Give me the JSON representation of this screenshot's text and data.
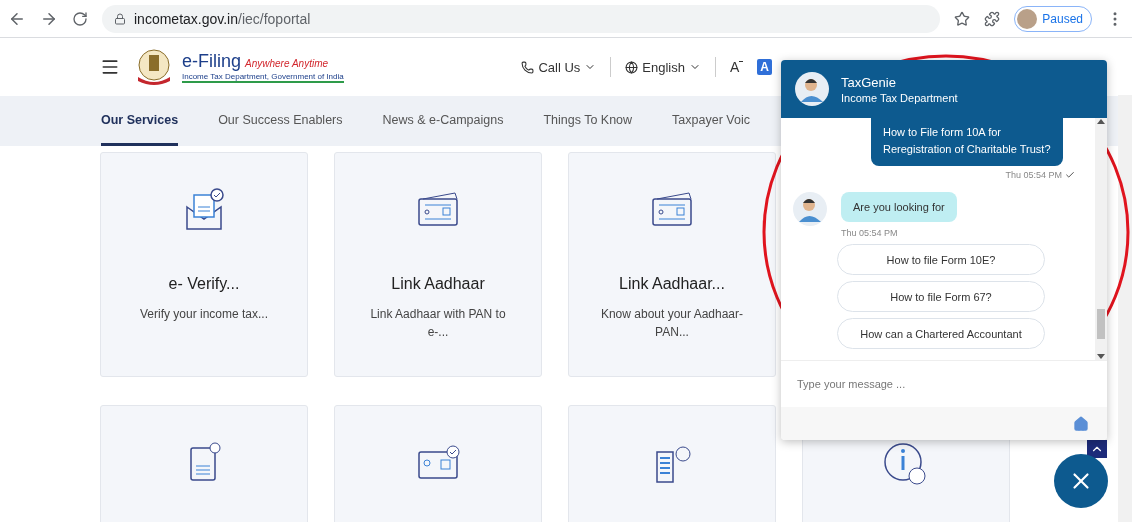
{
  "browser": {
    "url_domain": "incometax.gov.in",
    "url_path": "/iec/foportal",
    "profile_status": "Paused"
  },
  "header": {
    "logo_title": "e-Filing",
    "logo_tagline": "Anywhere Anytime",
    "logo_subtitle": "Income Tax Department, Government of India",
    "links": [
      {
        "label": "Call Us"
      },
      {
        "label": "English"
      }
    ],
    "font_decrease": "A",
    "font_badge": "A"
  },
  "nav": [
    {
      "label": "Our Services",
      "selected": true
    },
    {
      "label": "Our Success Enablers",
      "selected": false
    },
    {
      "label": "News & e-Campaigns",
      "selected": false
    },
    {
      "label": "Things To Know",
      "selected": false
    },
    {
      "label": "Taxpayer Voic",
      "selected": false
    }
  ],
  "cards": [
    {
      "title": "e- Verify...",
      "description": "Verify your income tax..."
    },
    {
      "title": "Link Aadhaar",
      "description": "Link Aadhaar with PAN to e-..."
    },
    {
      "title": "Link Aadhaar...",
      "description": "Know about your Aadhaar-PAN..."
    }
  ],
  "chat": {
    "title": "TaxGenie",
    "subtitle": "Income Tax Department",
    "messages": [
      {
        "kind": "user",
        "text": "How to File form 10A for Reregistration of Charitable Trust?",
        "time": "Thu 05:54 PM",
        "read": true
      },
      {
        "kind": "bot",
        "text": "Are you looking for",
        "time": "Thu 05:54 PM"
      }
    ],
    "suggestions": [
      "How to file Form 10E?",
      "How to file Form 67?",
      "How can a Chartered Accountant"
    ],
    "input": {
      "placeholder": "Type your message ..."
    }
  }
}
